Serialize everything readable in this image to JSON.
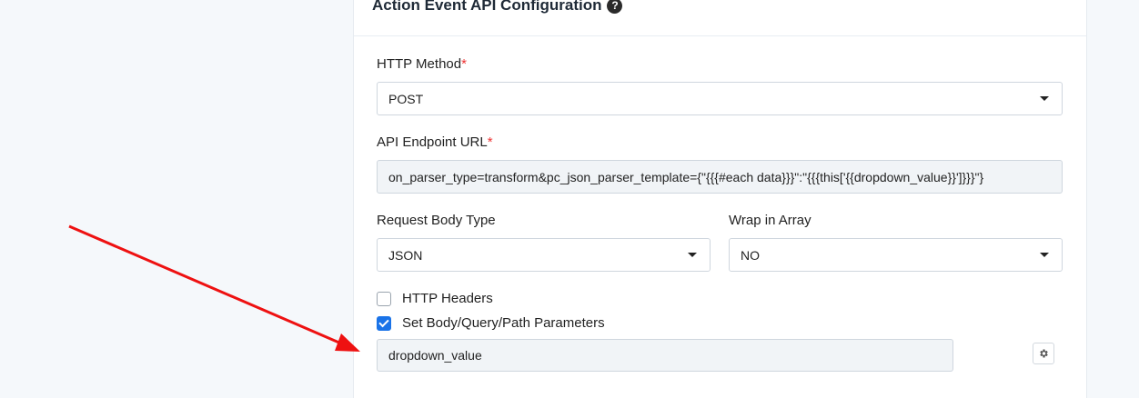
{
  "card": {
    "title": "Action Event API Configuration",
    "help_icon": "question-circle-icon"
  },
  "http_method": {
    "label": "HTTP Method",
    "required_mark": "*",
    "value": "POST"
  },
  "api_endpoint": {
    "label": "API Endpoint URL",
    "required_mark": "*",
    "value": "on_parser_type=transform&pc_json_parser_template={\"{{{#each data}}}\":\"{{{this['{{dropdown_value}}']}}}\"}"
  },
  "request_body_type": {
    "label": "Request Body Type",
    "value": "JSON"
  },
  "wrap_in_array": {
    "label": "Wrap in Array",
    "value": "NO"
  },
  "http_headers": {
    "label": "HTTP Headers",
    "checked": false
  },
  "set_params": {
    "label": "Set Body/Query/Path Parameters",
    "checked": true
  },
  "param_input": {
    "value": "dropdown_value"
  },
  "icons": {
    "gear": "gear-icon",
    "caret": "caret-down-icon",
    "annotation": "red-arrow"
  },
  "colors": {
    "accent": "#1a73e8",
    "required": "#ee3333",
    "annotation_arrow": "#ee1111"
  }
}
